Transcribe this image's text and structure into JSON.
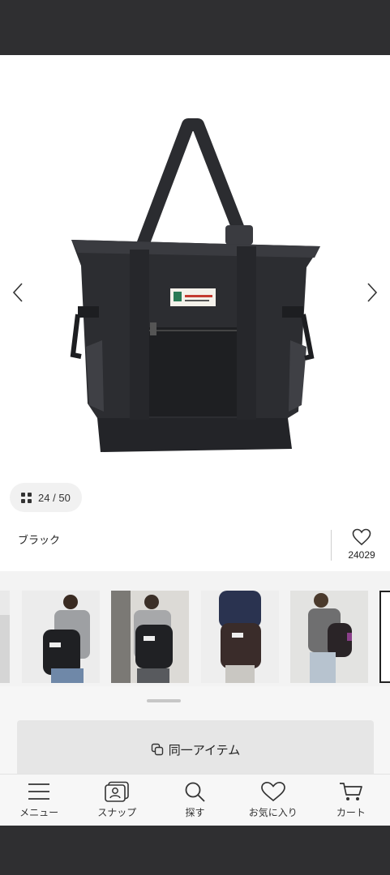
{
  "gallery": {
    "counter_current": "24",
    "counter_total": "50",
    "counter_separator": "/",
    "prev_icon": "chevron-left-icon",
    "next_icon": "chevron-right-icon",
    "product_logo_text": "[logo on bag]"
  },
  "product": {
    "color_name": "ブラック",
    "favorite_count": "24029",
    "favorite_icon": "heart-icon"
  },
  "snaps": {
    "count_visible": 6
  },
  "same_item": {
    "label": "同一アイテム",
    "icon": "copy-icon"
  },
  "tabbar": {
    "items": [
      {
        "label": "メニュー",
        "icon": "menu-icon"
      },
      {
        "label": "スナップ",
        "icon": "snap-icon"
      },
      {
        "label": "探す",
        "icon": "search-icon"
      },
      {
        "label": "お気に入り",
        "icon": "heart-icon"
      },
      {
        "label": "カート",
        "icon": "cart-icon"
      }
    ]
  },
  "colors": {
    "system_bar": "#2f2f31",
    "bag": "#2c2d31",
    "strip_bg": "#f3f3f3"
  }
}
